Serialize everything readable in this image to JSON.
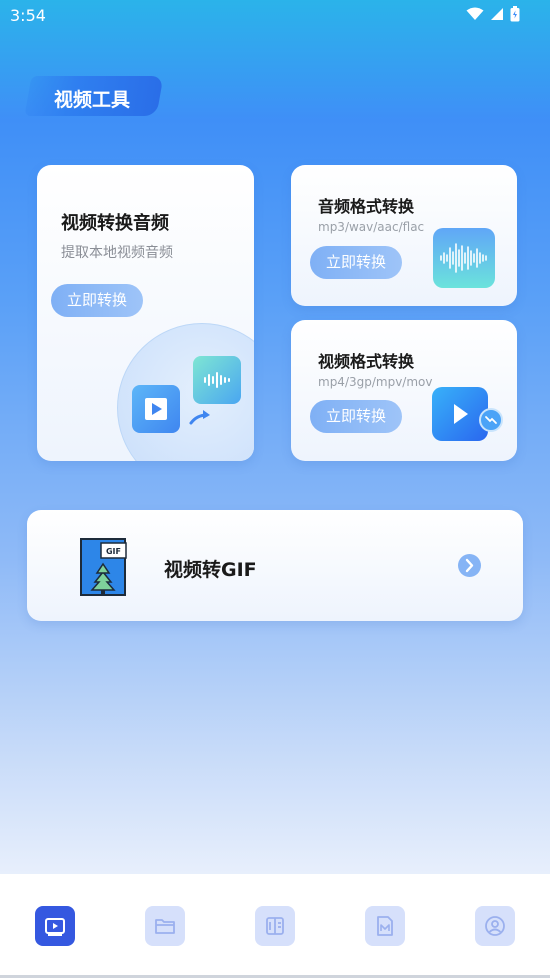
{
  "status_bar": {
    "time": "3:54"
  },
  "section": {
    "title": "视频工具"
  },
  "card_extract": {
    "title": "视频转换音频",
    "subtitle": "提取本地视频音频",
    "button": "立即转换"
  },
  "card_audio_format": {
    "title": "音频格式转换",
    "formats": "mp3/wav/aac/flac",
    "button": "立即转换"
  },
  "card_video_format": {
    "title": "视频格式转换",
    "formats": "mp4/3gp/mpv/mov",
    "button": "立即转换"
  },
  "card_gif": {
    "title": "视频转GIF",
    "icon_text": "GIF"
  },
  "tabbar": {
    "tabs": [
      {
        "icon": "video-icon",
        "active": true
      },
      {
        "icon": "folder-icon",
        "active": false
      },
      {
        "icon": "notebook-icon",
        "active": false
      },
      {
        "icon": "document-icon",
        "active": false
      },
      {
        "icon": "user-icon",
        "active": false
      }
    ]
  },
  "colors": {
    "accent": "#3558e0",
    "button": "#8ab7f6",
    "tab_inactive": "#d6e0fb"
  }
}
